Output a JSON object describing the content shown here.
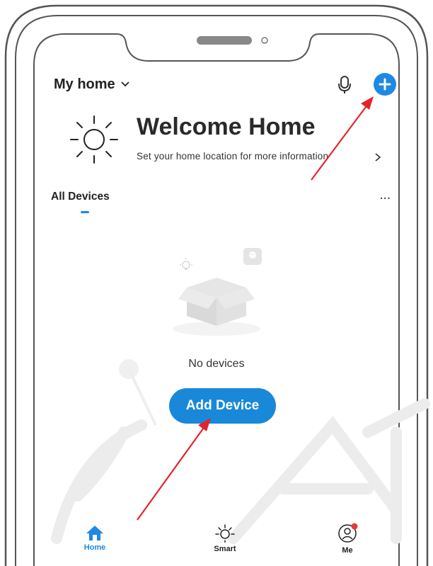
{
  "header": {
    "home_name": "My home",
    "chevron_icon": "chevron-down-icon",
    "mic_icon": "microphone-icon",
    "add_icon": "plus-icon"
  },
  "welcome": {
    "title": "Welcome Home",
    "subtitle": "Set your home location for more information",
    "icon": "sun-icon"
  },
  "tabs": {
    "all_devices": "All Devices",
    "more_label": "..."
  },
  "empty_state": {
    "message": "No devices",
    "button_label": "Add Device"
  },
  "bottom_nav": [
    {
      "label": "Home",
      "icon": "home-icon",
      "active": true
    },
    {
      "label": "Smart",
      "icon": "sun-icon",
      "active": false
    },
    {
      "label": "Me",
      "icon": "profile-icon",
      "active": false
    }
  ],
  "colors": {
    "accent": "#1e88e5",
    "annotation_arrow": "#e3242b",
    "notification_dot": "#e53935"
  }
}
